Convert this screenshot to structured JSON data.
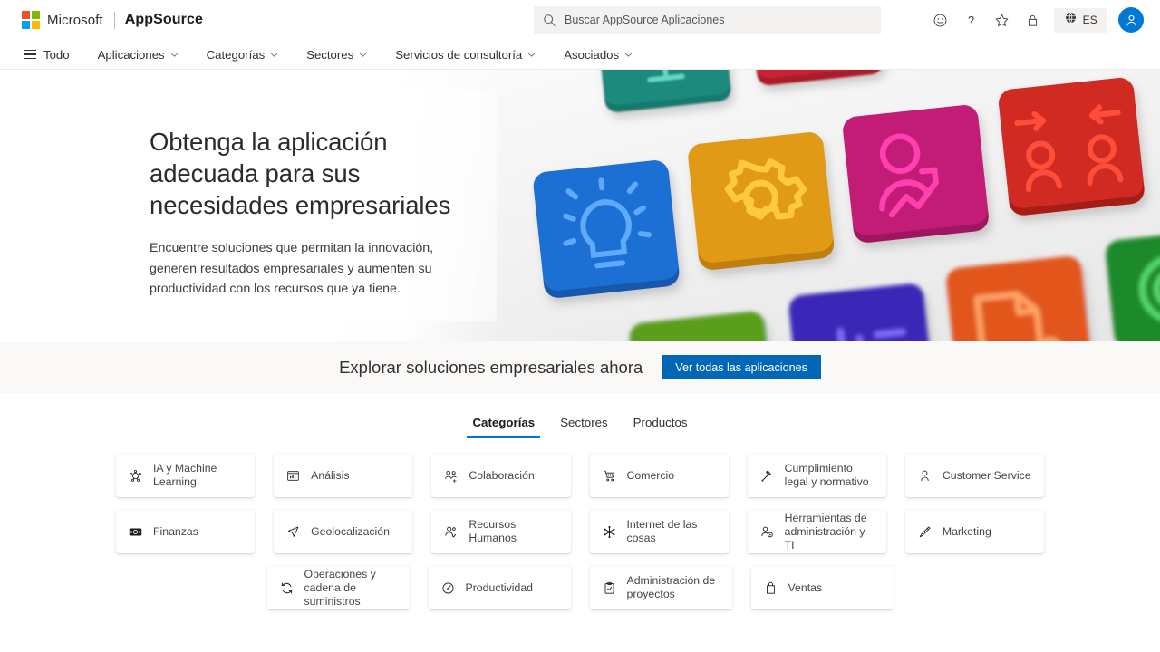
{
  "brand": {
    "microsoft": "Microsoft",
    "product": "AppSource"
  },
  "search": {
    "placeholder": "Buscar AppSource Aplicaciones",
    "value": ""
  },
  "topbar": {
    "icons": [
      "feedback-smiley-icon",
      "help-question-icon",
      "favorites-star-icon",
      "privacy-lock-icon"
    ],
    "language_code": "ES"
  },
  "nav": {
    "items": [
      {
        "label": "Todo",
        "has_chevron": false,
        "has_hamburger": true
      },
      {
        "label": "Aplicaciones",
        "has_chevron": true,
        "has_hamburger": false
      },
      {
        "label": "Categorías",
        "has_chevron": true,
        "has_hamburger": false
      },
      {
        "label": "Sectores",
        "has_chevron": true,
        "has_hamburger": false
      },
      {
        "label": "Servicios de consultoría",
        "has_chevron": true,
        "has_hamburger": false
      },
      {
        "label": "Asociados",
        "has_chevron": true,
        "has_hamburger": false
      }
    ]
  },
  "hero": {
    "title": "Obtenga la aplicación adecuada para sus necesidades empresariales",
    "subtitle": "Encuentre soluciones que permitan la innovación, generen resultados empresariales y aumenten su productividad con los recursos que ya tiene.",
    "tile_colors": [
      "#1a8b7e",
      "#cc2236",
      "#2b2b2b",
      "#e09a14",
      "#1f6fd4",
      "#e09a14",
      "#c21f77",
      "#d02a20",
      "#5a9e1f",
      "#3b27b8",
      "#e2561e",
      "#1b8a2c"
    ]
  },
  "explore": {
    "text": "Explorar soluciones empresariales ahora",
    "button_label": "Ver todas las aplicaciones",
    "button_color": "#0067b8"
  },
  "tabs": {
    "items": [
      {
        "label": "Categorías",
        "active": true
      },
      {
        "label": "Sectores",
        "active": false
      },
      {
        "label": "Productos",
        "active": false
      }
    ]
  },
  "categories": {
    "rows": [
      [
        {
          "label": "IA y Machine Learning",
          "icon": "ai-network-icon"
        },
        {
          "label": "Análisis",
          "icon": "analytics-chart-icon"
        },
        {
          "label": "Colaboración",
          "icon": "collaboration-people-icon"
        },
        {
          "label": "Comercio",
          "icon": "shopping-cart-icon"
        },
        {
          "label": "Cumplimiento legal y normativo",
          "icon": "gavel-icon"
        },
        {
          "label": "Customer Service",
          "icon": "person-headset-icon"
        }
      ],
      [
        {
          "label": "Finanzas",
          "icon": "money-bill-icon"
        },
        {
          "label": "Geolocalización",
          "icon": "location-arrow-icon"
        },
        {
          "label": "Recursos Humanos",
          "icon": "person-check-icon"
        },
        {
          "label": "Internet de las cosas",
          "icon": "iot-nodes-icon"
        },
        {
          "label": "Herramientas de administración y TI",
          "icon": "person-settings-icon"
        },
        {
          "label": "Marketing",
          "icon": "megaphone-pen-icon"
        }
      ],
      [
        {
          "label": "Operaciones y cadena de suministros",
          "icon": "refresh-cycle-icon"
        },
        {
          "label": "Productividad",
          "icon": "gauge-icon"
        },
        {
          "label": "Administración de proyectos",
          "icon": "clipboard-check-icon"
        },
        {
          "label": "Ventas",
          "icon": "briefcase-bag-icon"
        }
      ]
    ]
  }
}
